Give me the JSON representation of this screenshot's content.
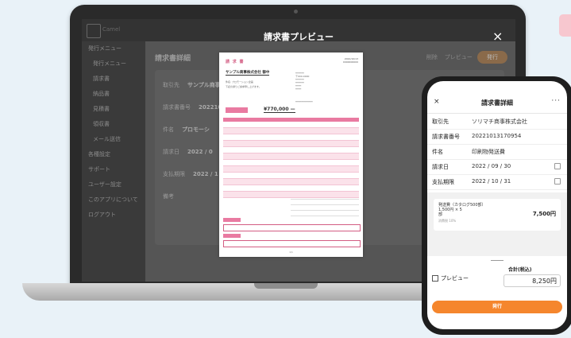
{
  "app": {
    "logo_text": "Camel",
    "sidebar": [
      {
        "label": "発行メニュー",
        "sub": false
      },
      {
        "label": "発行メニュー",
        "sub": true
      },
      {
        "label": "請求書",
        "sub": true
      },
      {
        "label": "納品書",
        "sub": true
      },
      {
        "label": "見積書",
        "sub": true
      },
      {
        "label": "領収書",
        "sub": true
      },
      {
        "label": "メール送信",
        "sub": true
      },
      {
        "label": "各種設定",
        "sub": false
      },
      {
        "label": "サポート",
        "sub": false
      },
      {
        "label": "ユーザー設定",
        "sub": false
      },
      {
        "label": "このアプリについて",
        "sub": false
      },
      {
        "label": "ログアウト",
        "sub": false
      }
    ],
    "main_title": "請求書詳細",
    "toolbar": {
      "delete": "削除",
      "preview": "プレビュー",
      "issue": "発行"
    },
    "rows": [
      {
        "label": "取引先",
        "value": "サンプル商事"
      },
      {
        "label": "請求書番号",
        "value": "2022101"
      },
      {
        "label": "件名",
        "value": "プロモーシ"
      },
      {
        "label": "請求日",
        "value": "2022 / 0"
      },
      {
        "label": "支払期限",
        "value": "2022 / 1"
      },
      {
        "label": "備考",
        "value": ""
      }
    ]
  },
  "modal": {
    "title": "請求書プレビュー",
    "close_icon": "×"
  },
  "paper": {
    "title": "請 求 書",
    "to": "サンプル商事株式会社 御中",
    "subject": "件名: プロモーション企画",
    "greeting": "下記の通りご請求申し上げます。",
    "total": "¥770,000 —"
  },
  "phone": {
    "close_icon": "×",
    "title": "請求書詳細",
    "more_icon": "···",
    "rows": [
      {
        "label": "取引先",
        "value": "ソリマチ商事株式会社",
        "cal": false
      },
      {
        "label": "請求書番号",
        "value": "20221013170954",
        "cal": false
      },
      {
        "label": "件名",
        "value": "印刷物発送費",
        "cal": false
      },
      {
        "label": "請求日",
        "value": "2022 / 09 / 30",
        "cal": true
      },
      {
        "label": "支払期限",
        "value": "2022 / 10 / 31",
        "cal": true
      },
      {
        "label": "備考",
        "value": "",
        "cal": false
      }
    ],
    "item": {
      "name": "発送費（カタログ500部）",
      "qty": "1,500円 × 5",
      "unit": "部",
      "note": "消費税 10%",
      "price": "7,500円"
    },
    "total_label": "合計(税込)",
    "total_value": "8,250円",
    "preview_label": "プレビュー",
    "issue_button": "発行"
  }
}
